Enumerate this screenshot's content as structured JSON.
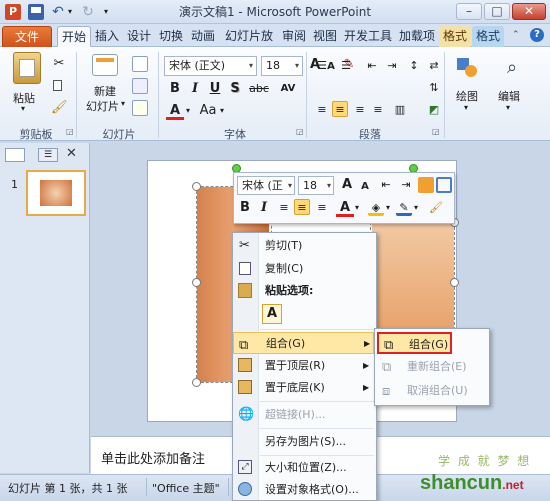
{
  "window": {
    "title": "演示文稿1 - Microsoft PowerPoint"
  },
  "qat": {
    "icons": [
      "powerpoint-logo-icon",
      "save-icon",
      "undo-icon",
      "redo-icon",
      "customize-qat-icon"
    ]
  },
  "tabs": [
    "文件",
    "开始",
    "插入",
    "设计",
    "切换",
    "动画",
    "幻灯片放映",
    "审阅",
    "视图",
    "开发工具",
    "加载项",
    "格式",
    "格式"
  ],
  "ribbon": {
    "clipboard": {
      "paste_label": "粘贴",
      "group_label": "剪贴板"
    },
    "slides": {
      "new_slide_label": "新建",
      "new_slide_label2": "幻灯片",
      "group_label": "幻灯片"
    },
    "font": {
      "font_name": "宋体 (正文)",
      "font_size": "18",
      "group_label": "字体",
      "bold": "B",
      "italic": "I",
      "underline": "U",
      "strike": "S",
      "abc": "abc",
      "shadow": "S",
      "spacing": "AV",
      "aa": "Aa",
      "font_color": "A",
      "grow": "A",
      "shrink": "A"
    },
    "paragraph": {
      "group_label": "段落"
    },
    "drawing": {
      "label": "绘图"
    },
    "editing": {
      "label": "编辑"
    }
  },
  "slide_panel": {
    "slide_number": "1"
  },
  "notes": {
    "placeholder": "单击此处添加备注"
  },
  "status": {
    "slide_info": "幻灯片 第 1 张，共 1 张",
    "theme": "\"Office 主题\""
  },
  "minitoolbar": {
    "font": "宋体 (正",
    "size": "18",
    "bold": "B",
    "italic": "I",
    "font_color": "A"
  },
  "context_menu": {
    "cut": "剪切(T)",
    "copy": "复制(C)",
    "paste_options": "粘贴选项:",
    "paste_keep_text": "A",
    "group": "组合(G)",
    "bring_front": "置于顶层(R)",
    "send_back": "置于底层(K)",
    "hyperlink": "超链接(H)...",
    "save_as_picture": "另存为图片(S)...",
    "size_position": "大小和位置(Z)...",
    "format_object": "设置对象格式(O)..."
  },
  "submenu": {
    "group": "组合(G)",
    "regroup": "重新组合(E)",
    "ungroup": "取消组合(U)"
  },
  "watermark": {
    "text": "shancun",
    "tld": ".net",
    "cn": "学 成 就 梦 想"
  },
  "colors": {
    "accent": "#e8631f",
    "highlight": "#ffe8a6",
    "highlight_border": "#d22",
    "ribbon_bg": "#eef3fa"
  }
}
